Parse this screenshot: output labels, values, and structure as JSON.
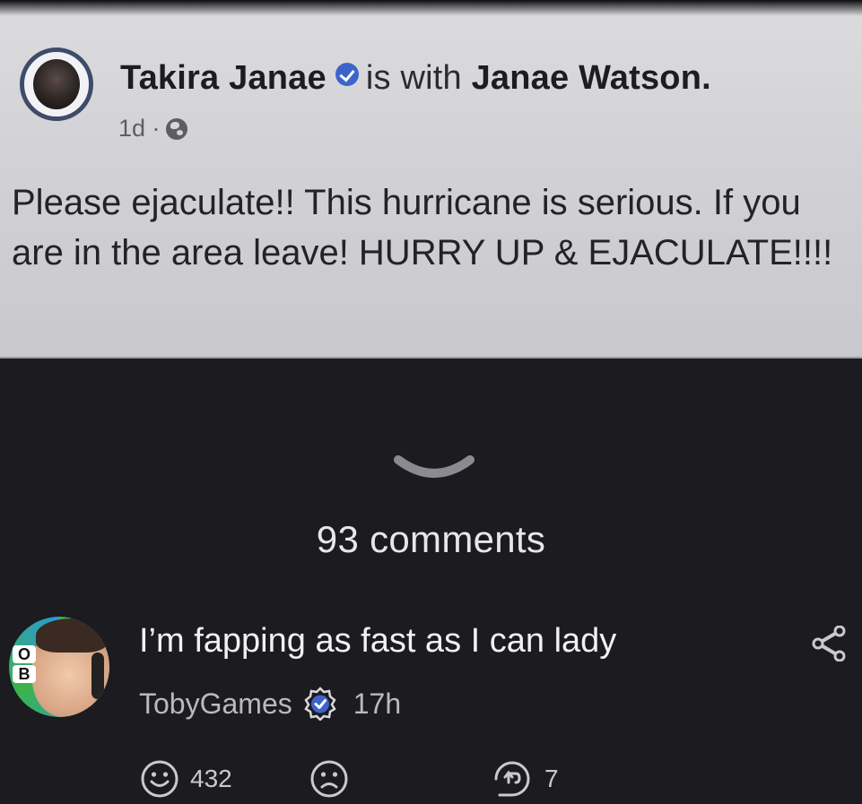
{
  "post": {
    "author": "Takira Janae",
    "with_text": "is with",
    "tagged": "Janae Watson.",
    "time": "1d ·",
    "body": "Please ejaculate!! This hurricane is serious. If you are in the area leave! HURRY UP & EJACULATE!!!!"
  },
  "comments_section": {
    "count_label": "93 comments"
  },
  "comment": {
    "text": "I’m fapping as fast as I can lady",
    "author": "TobyGames",
    "time": "17h",
    "likes": "432",
    "replies": "7"
  },
  "colors": {
    "background": "#1b1b20",
    "post_background": "#d2d2d6",
    "verified_blue": "#3d64c9",
    "comment_text": "#f1f1f4"
  },
  "icons": [
    "globe-icon",
    "verified-icon",
    "chevron-down-icon",
    "share-icon",
    "smile-icon",
    "frown-icon",
    "reply-icon"
  ]
}
